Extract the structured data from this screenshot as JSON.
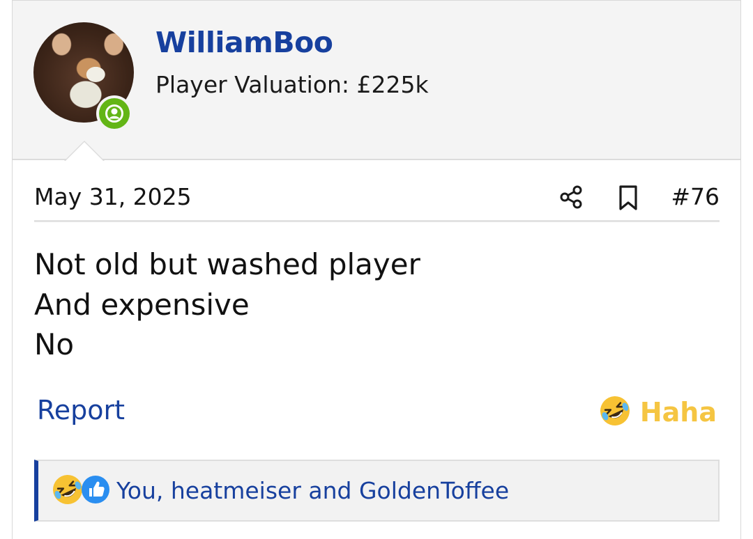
{
  "post": {
    "author": {
      "username": "WilliamBoo",
      "title": "Player Valuation: £225k",
      "status": "online",
      "status_color": "#63b516"
    },
    "date": "May 31, 2025",
    "post_number": "#76",
    "body_lines": [
      "Not old but washed player",
      "And expensive",
      "No"
    ],
    "actions": {
      "report_label": "Report",
      "reaction_label": "Haha",
      "reaction_icon": "laughing-emoji-icon",
      "share_icon": "share-icon",
      "bookmark_icon": "bookmark-icon"
    },
    "reactions_summary": {
      "icons": [
        "laughing-emoji-icon",
        "like-thumb-icon"
      ],
      "text": "You, heatmeiser and GoldenToffee"
    }
  },
  "colors": {
    "link": "#17409e",
    "haha": "#f5c542",
    "online": "#63b516",
    "header_bg": "#f4f4f4"
  }
}
